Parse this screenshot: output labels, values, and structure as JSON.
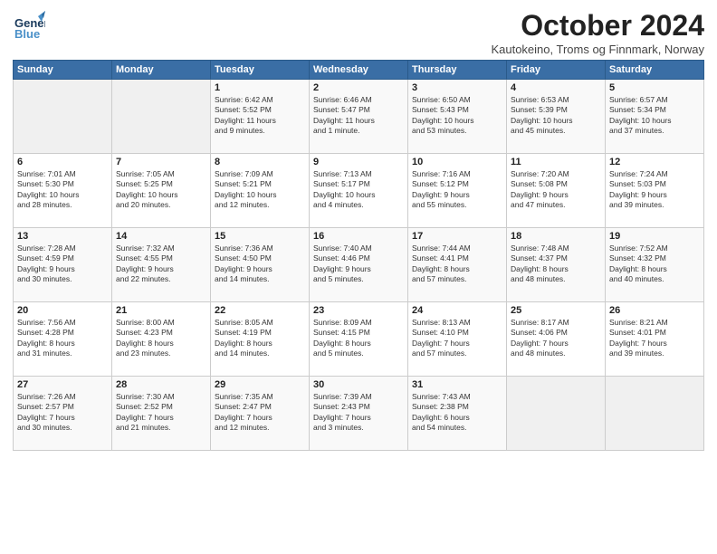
{
  "header": {
    "logo_general": "General",
    "logo_blue": "Blue",
    "month": "October 2024",
    "location": "Kautokeino, Troms og Finnmark, Norway"
  },
  "weekdays": [
    "Sunday",
    "Monday",
    "Tuesday",
    "Wednesday",
    "Thursday",
    "Friday",
    "Saturday"
  ],
  "weeks": [
    [
      {
        "day": "",
        "info": ""
      },
      {
        "day": "",
        "info": ""
      },
      {
        "day": "1",
        "info": "Sunrise: 6:42 AM\nSunset: 5:52 PM\nDaylight: 11 hours\nand 9 minutes."
      },
      {
        "day": "2",
        "info": "Sunrise: 6:46 AM\nSunset: 5:47 PM\nDaylight: 11 hours\nand 1 minute."
      },
      {
        "day": "3",
        "info": "Sunrise: 6:50 AM\nSunset: 5:43 PM\nDaylight: 10 hours\nand 53 minutes."
      },
      {
        "day": "4",
        "info": "Sunrise: 6:53 AM\nSunset: 5:39 PM\nDaylight: 10 hours\nand 45 minutes."
      },
      {
        "day": "5",
        "info": "Sunrise: 6:57 AM\nSunset: 5:34 PM\nDaylight: 10 hours\nand 37 minutes."
      }
    ],
    [
      {
        "day": "6",
        "info": "Sunrise: 7:01 AM\nSunset: 5:30 PM\nDaylight: 10 hours\nand 28 minutes."
      },
      {
        "day": "7",
        "info": "Sunrise: 7:05 AM\nSunset: 5:25 PM\nDaylight: 10 hours\nand 20 minutes."
      },
      {
        "day": "8",
        "info": "Sunrise: 7:09 AM\nSunset: 5:21 PM\nDaylight: 10 hours\nand 12 minutes."
      },
      {
        "day": "9",
        "info": "Sunrise: 7:13 AM\nSunset: 5:17 PM\nDaylight: 10 hours\nand 4 minutes."
      },
      {
        "day": "10",
        "info": "Sunrise: 7:16 AM\nSunset: 5:12 PM\nDaylight: 9 hours\nand 55 minutes."
      },
      {
        "day": "11",
        "info": "Sunrise: 7:20 AM\nSunset: 5:08 PM\nDaylight: 9 hours\nand 47 minutes."
      },
      {
        "day": "12",
        "info": "Sunrise: 7:24 AM\nSunset: 5:03 PM\nDaylight: 9 hours\nand 39 minutes."
      }
    ],
    [
      {
        "day": "13",
        "info": "Sunrise: 7:28 AM\nSunset: 4:59 PM\nDaylight: 9 hours\nand 30 minutes."
      },
      {
        "day": "14",
        "info": "Sunrise: 7:32 AM\nSunset: 4:55 PM\nDaylight: 9 hours\nand 22 minutes."
      },
      {
        "day": "15",
        "info": "Sunrise: 7:36 AM\nSunset: 4:50 PM\nDaylight: 9 hours\nand 14 minutes."
      },
      {
        "day": "16",
        "info": "Sunrise: 7:40 AM\nSunset: 4:46 PM\nDaylight: 9 hours\nand 5 minutes."
      },
      {
        "day": "17",
        "info": "Sunrise: 7:44 AM\nSunset: 4:41 PM\nDaylight: 8 hours\nand 57 minutes."
      },
      {
        "day": "18",
        "info": "Sunrise: 7:48 AM\nSunset: 4:37 PM\nDaylight: 8 hours\nand 48 minutes."
      },
      {
        "day": "19",
        "info": "Sunrise: 7:52 AM\nSunset: 4:32 PM\nDaylight: 8 hours\nand 40 minutes."
      }
    ],
    [
      {
        "day": "20",
        "info": "Sunrise: 7:56 AM\nSunset: 4:28 PM\nDaylight: 8 hours\nand 31 minutes."
      },
      {
        "day": "21",
        "info": "Sunrise: 8:00 AM\nSunset: 4:23 PM\nDaylight: 8 hours\nand 23 minutes."
      },
      {
        "day": "22",
        "info": "Sunrise: 8:05 AM\nSunset: 4:19 PM\nDaylight: 8 hours\nand 14 minutes."
      },
      {
        "day": "23",
        "info": "Sunrise: 8:09 AM\nSunset: 4:15 PM\nDaylight: 8 hours\nand 5 minutes."
      },
      {
        "day": "24",
        "info": "Sunrise: 8:13 AM\nSunset: 4:10 PM\nDaylight: 7 hours\nand 57 minutes."
      },
      {
        "day": "25",
        "info": "Sunrise: 8:17 AM\nSunset: 4:06 PM\nDaylight: 7 hours\nand 48 minutes."
      },
      {
        "day": "26",
        "info": "Sunrise: 8:21 AM\nSunset: 4:01 PM\nDaylight: 7 hours\nand 39 minutes."
      }
    ],
    [
      {
        "day": "27",
        "info": "Sunrise: 7:26 AM\nSunset: 2:57 PM\nDaylight: 7 hours\nand 30 minutes."
      },
      {
        "day": "28",
        "info": "Sunrise: 7:30 AM\nSunset: 2:52 PM\nDaylight: 7 hours\nand 21 minutes."
      },
      {
        "day": "29",
        "info": "Sunrise: 7:35 AM\nSunset: 2:47 PM\nDaylight: 7 hours\nand 12 minutes."
      },
      {
        "day": "30",
        "info": "Sunrise: 7:39 AM\nSunset: 2:43 PM\nDaylight: 7 hours\nand 3 minutes."
      },
      {
        "day": "31",
        "info": "Sunrise: 7:43 AM\nSunset: 2:38 PM\nDaylight: 6 hours\nand 54 minutes."
      },
      {
        "day": "",
        "info": ""
      },
      {
        "day": "",
        "info": ""
      }
    ]
  ]
}
